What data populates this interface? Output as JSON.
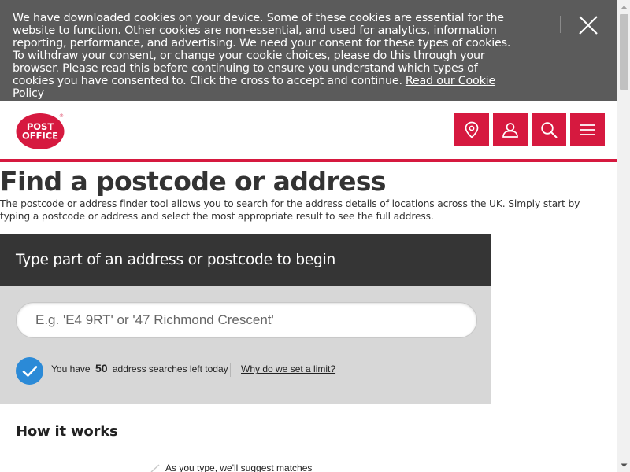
{
  "cookie_banner": {
    "message": "We have downloaded cookies on your device. Some of these cookies are essential for the website to function. Other cookies are non-essential, and used for analytics, information reporting, performance, and advertising. We need your consent for these types of cookies. To withdraw your consent, or change your cookie choices, please do this through your browser. Please read this before continuing to ensure you understand which types of cookies you have consented to. Click the cross to accept and continue.",
    "link_label": "Read our Cookie Policy",
    "close_icon": "close-icon"
  },
  "header": {
    "logo": {
      "line1": "POST",
      "line2": "OFFICE",
      "mark": "®"
    },
    "buttons": [
      {
        "icon": "location-pin-icon"
      },
      {
        "icon": "user-icon"
      },
      {
        "icon": "search-icon"
      },
      {
        "icon": "menu-icon"
      }
    ]
  },
  "main": {
    "title": "Find a postcode or address",
    "intro": "The postcode or address finder tool allows you to search for the address details of locations across the UK. Simply start by typing a postcode or address and select the most appropriate result to see the full address.",
    "finder": {
      "heading": "Type part of an address or postcode to begin",
      "placeholder": "E.g. 'E4 9RT' or '47 Richmond Crescent'",
      "limit_prefix": "You have",
      "limit_count": "50",
      "limit_suffix": "address searches left today",
      "why_link": "Why do we set a limit?"
    },
    "how_it_works": {
      "heading": "How it works",
      "steps": [
        {
          "text": "As you type, we'll suggest matches"
        }
      ]
    }
  },
  "colors": {
    "brand_red": "#d6193f",
    "banner_grey": "#5b5b5b",
    "finder_dark": "#353535",
    "finder_light": "#d7d7d7",
    "tick_blue": "#2b8ad7"
  }
}
